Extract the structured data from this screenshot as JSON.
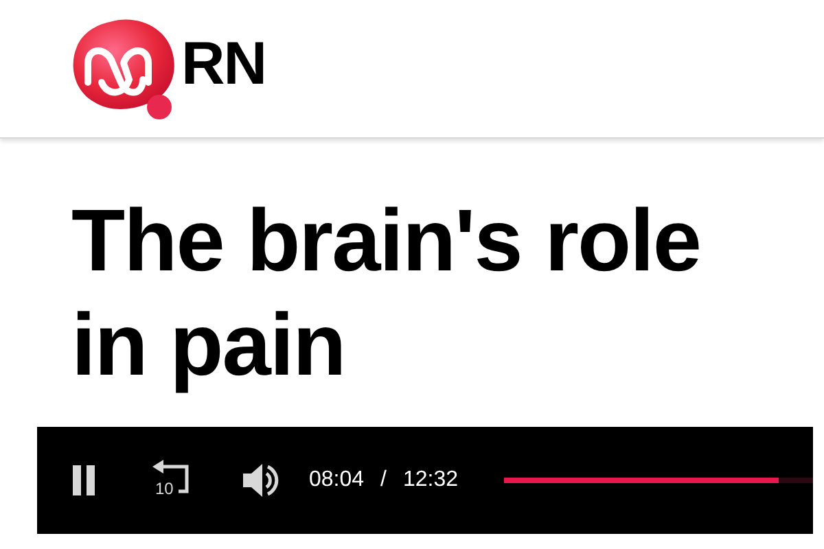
{
  "header": {
    "logo_text": "RN"
  },
  "article": {
    "title": "The brain's role in pain"
  },
  "player": {
    "playing": true,
    "rewind_seconds": "10",
    "muted": false,
    "current_time": "08:04",
    "separator": "/",
    "duration": "12:32",
    "progress": {
      "level": 0.89
    }
  }
}
